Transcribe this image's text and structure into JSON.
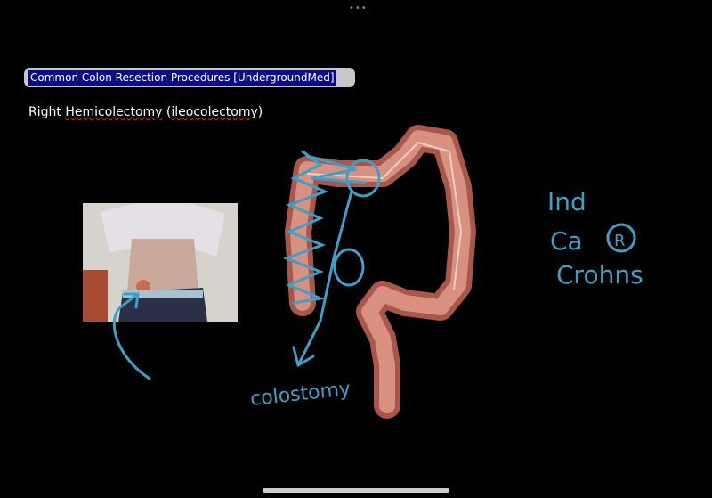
{
  "page": {
    "title": "Common Colon Resection Procedures [UndergroundMed]",
    "subtitle_prefix": "Right ",
    "subtitle_word1": "Hemicolectomy",
    "subtitle_mid": " (",
    "subtitle_word2": "ileocolectomy",
    "subtitle_suffix": ")"
  },
  "annotations": {
    "ind": "Ind",
    "ca": "Ca",
    "r": "R",
    "crohns": "Crohns",
    "colostomy": "colostomy"
  },
  "colors": {
    "ink": "#3ca0c8",
    "title_highlight": "#0a0a8c"
  },
  "toolbar": {
    "more_icon": "•••"
  }
}
